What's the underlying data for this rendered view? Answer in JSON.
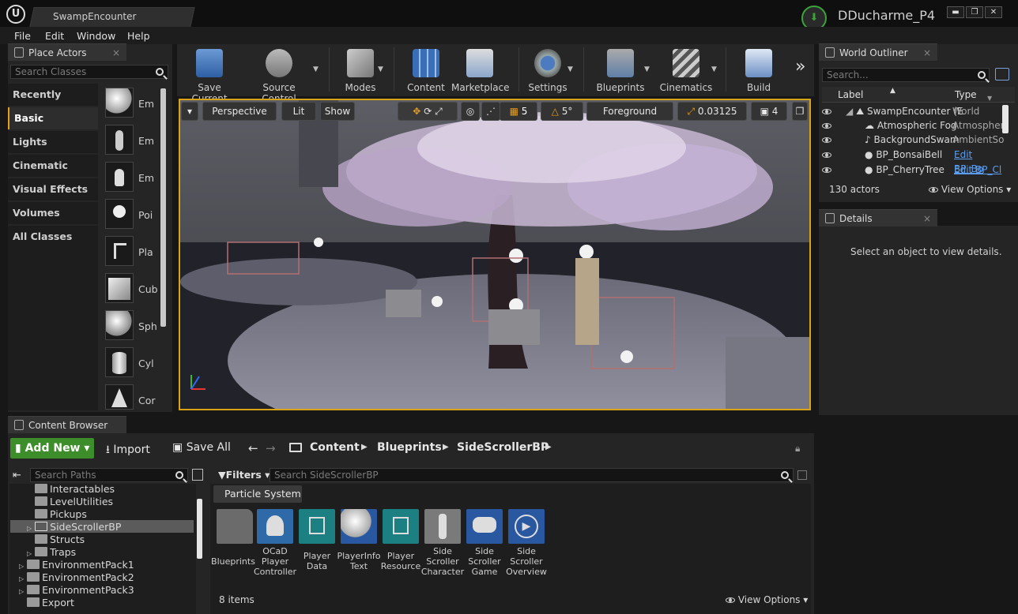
{
  "window": {
    "doc_tab": "SwampEncounter",
    "user": "DDucharme_P4",
    "logo_icon": "unreal-logo-icon",
    "minimize": "▬",
    "maximize": "❐",
    "close": "✕"
  },
  "menu": [
    "File",
    "Edit",
    "Window",
    "Help"
  ],
  "place_actors": {
    "tab_label": "Place Actors",
    "search_placeholder": "Search Classes",
    "categories": [
      "Recently Placed",
      "Basic",
      "Lights",
      "Cinematic",
      "Visual Effects",
      "Volumes",
      "All Classes"
    ],
    "active_category": "Basic",
    "actors": [
      "Em",
      "Em",
      "Em",
      "Poi",
      "Pla",
      "Cub",
      "Sph",
      "Cyl",
      "Cor"
    ]
  },
  "toolbar": {
    "buttons": [
      {
        "label": "Save Current",
        "icon": "save-icon"
      },
      {
        "label": "Source Control",
        "icon": "source-control-icon"
      },
      {
        "label": "Modes",
        "icon": "modes-icon"
      },
      {
        "label": "Content",
        "icon": "content-icon"
      },
      {
        "label": "Marketplace",
        "icon": "marketplace-icon"
      },
      {
        "label": "Settings",
        "icon": "settings-icon"
      },
      {
        "label": "Blueprints",
        "icon": "blueprints-icon"
      },
      {
        "label": "Cinematics",
        "icon": "cinematics-icon"
      },
      {
        "label": "Build",
        "icon": "build-icon"
      }
    ],
    "overflow": "»"
  },
  "viewport": {
    "perspective": "Perspective",
    "lit": "Lit",
    "show": "Show",
    "grid_snap": "5",
    "rotation_snap": "5°",
    "layer": "Foreground",
    "scale_snap": "0.03125",
    "camera_speed": "4"
  },
  "world_outliner": {
    "tab_label": "World Outliner",
    "search_placeholder": "Search...",
    "col_label": "Label",
    "col_type": "Type",
    "rows": [
      {
        "label": "SwampEncounter (E",
        "type": "World",
        "link": false
      },
      {
        "label": "Atmospheric Fog",
        "type": "Atmospher",
        "link": false
      },
      {
        "label": "BackgroundSwam",
        "type": "AmbientSo",
        "link": false
      },
      {
        "label": "BP_BonsaiBell",
        "type": "Edit BP_Bo",
        "link": true
      },
      {
        "label": "BP_CherryTree",
        "type": "Edit BP_Cl",
        "link": true
      }
    ],
    "count": "130 actors",
    "view_options": "View Options"
  },
  "details": {
    "tab_label": "Details",
    "empty_text": "Select an object to view details."
  },
  "content_browser": {
    "tab_label": "Content Browser",
    "add_new": "Add New",
    "import": "Import",
    "save_all": "Save All",
    "breadcrumb": [
      "Content",
      "Blueprints",
      "SideScrollerBP"
    ],
    "paths_placeholder": "Search Paths",
    "filters": "Filters",
    "search_placeholder": "Search SideScrollerBP",
    "active_filter": "Particle System",
    "tree": [
      {
        "label": "Interactables",
        "indent": 1,
        "expand": false
      },
      {
        "label": "LevelUtilities",
        "indent": 1,
        "expand": false
      },
      {
        "label": "Pickups",
        "indent": 1,
        "expand": false
      },
      {
        "label": "SideScrollerBP",
        "indent": 1,
        "expand": true,
        "selected": true
      },
      {
        "label": "Structs",
        "indent": 1,
        "expand": false
      },
      {
        "label": "Traps",
        "indent": 1,
        "expand": true
      },
      {
        "label": "EnvironmentPack1",
        "indent": 0,
        "expand": true
      },
      {
        "label": "EnvironmentPack2",
        "indent": 0,
        "expand": true
      },
      {
        "label": "EnvironmentPack3",
        "indent": 0,
        "expand": true
      },
      {
        "label": "Export",
        "indent": 0,
        "expand": false
      }
    ],
    "assets": [
      {
        "label": "Blueprints",
        "icon": "folder-icon",
        "color": "#6b6b6b"
      },
      {
        "label": "OCaD Player Controller",
        "icon": "player-controller-icon",
        "color": "#2e6aa8"
      },
      {
        "label": "Player Data",
        "icon": "data-icon",
        "color": "#1c7f82"
      },
      {
        "label": "PlayerInfo Text",
        "icon": "sphere-icon",
        "color": "#2a58a0"
      },
      {
        "label": "Player Resource",
        "icon": "data-icon",
        "color": "#1c7f82"
      },
      {
        "label": "Side Scroller Character",
        "icon": "character-icon",
        "color": "#7a7a7a"
      },
      {
        "label": "Side Scroller Game",
        "icon": "gamemode-icon",
        "color": "#2a58a0"
      },
      {
        "label": "Side Scroller Overview",
        "icon": "play-icon",
        "color": "#2a58a0"
      }
    ],
    "item_count": "8 items",
    "view_options": "View Options"
  }
}
